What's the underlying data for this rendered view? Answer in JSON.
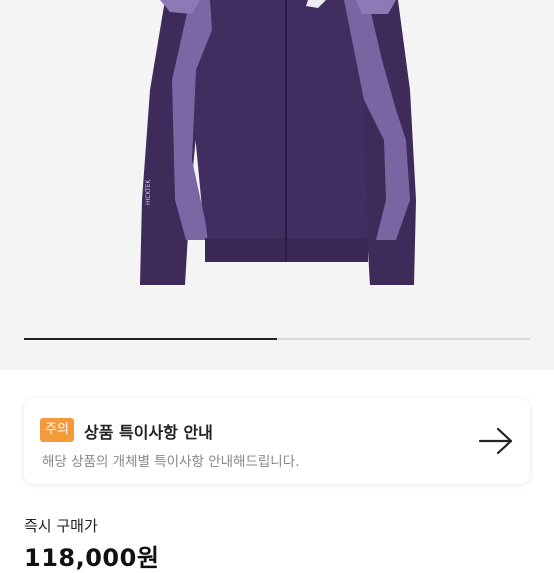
{
  "product": {
    "image_icon": "purple-zip-jacket",
    "carousel": {
      "current": 1,
      "total": 2
    },
    "brand_text": "HICKTEK"
  },
  "notice": {
    "badge": "주의",
    "title": "상품 특이사항 안내",
    "description": "해당 상품의 개체별 특이사항 안내해드립니다.",
    "arrow_icon": "arrow-right-icon",
    "badge_color": "#f59a3a"
  },
  "price": {
    "label": "즉시 구매가",
    "value": "118,000원"
  }
}
